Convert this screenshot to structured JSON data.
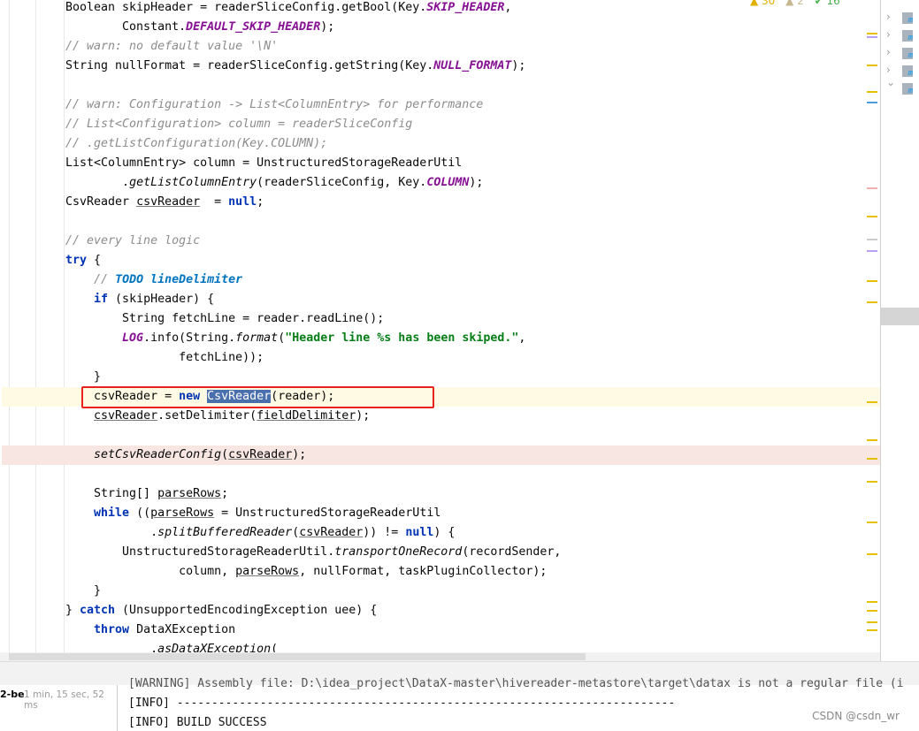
{
  "editor": {
    "lines": [
      [
        [
          "Boolean skipHeader = readerSliceConfig.getBool(Key.",
          ""
        ],
        [
          "SKIP_HEADER",
          "cn"
        ],
        [
          ",",
          ""
        ]
      ],
      [
        [
          "        Constant.",
          ""
        ],
        [
          "DEFAULT_SKIP_HEADER",
          "cn"
        ],
        [
          ");",
          ""
        ]
      ],
      [
        [
          "// warn: no default value '\\N'",
          "cm"
        ]
      ],
      [
        [
          "String nullFormat = readerSliceConfig.getString(Key.",
          ""
        ],
        [
          "NULL_FORMAT",
          "cn"
        ],
        [
          ");",
          ""
        ]
      ],
      [],
      [
        [
          "// warn: Configuration -> List<ColumnEntry> for performance",
          "cm"
        ]
      ],
      [
        [
          "// List<Configuration> column = readerSliceConfig",
          "cm"
        ]
      ],
      [
        [
          "// .getListConfiguration(Key.COLUMN);",
          "cm"
        ]
      ],
      [
        [
          "List<ColumnEntry> column = UnstructuredStorageReaderUtil",
          ""
        ]
      ],
      [
        [
          "        .",
          ""
        ],
        [
          "getListColumnEntry",
          "it"
        ],
        [
          "(readerSliceConfig, Key.",
          ""
        ],
        [
          "COLUMN",
          "cn"
        ],
        [
          ");",
          ""
        ]
      ],
      [
        [
          "CsvReader ",
          ""
        ],
        [
          "csvReader",
          "ul"
        ],
        [
          "  = ",
          ""
        ],
        [
          "null",
          "kw"
        ],
        [
          ";",
          ""
        ]
      ],
      [],
      [
        [
          "// every line logic",
          "cm"
        ]
      ],
      [
        [
          "try",
          "kw"
        ],
        [
          " {",
          ""
        ]
      ],
      [
        [
          "    ",
          ""
        ],
        [
          "// ",
          "cm"
        ],
        [
          "TODO lineDelimiter",
          "todo"
        ]
      ],
      [
        [
          "    ",
          ""
        ],
        [
          "if",
          "kw"
        ],
        [
          " (skipHeader) {",
          ""
        ]
      ],
      [
        [
          "        String fetchLine = reader.readLine();",
          ""
        ]
      ],
      [
        [
          "        ",
          ""
        ],
        [
          "LOG",
          "cn"
        ],
        [
          ".info(String.",
          ""
        ],
        [
          "format",
          "it"
        ],
        [
          "(",
          ""
        ],
        [
          "\"Header line %s has been skiped.\"",
          "st"
        ],
        [
          ",",
          ""
        ]
      ],
      [
        [
          "                fetchLine));",
          ""
        ]
      ],
      [
        [
          "    }",
          ""
        ]
      ],
      [
        [
          "    csvReader = ",
          ""
        ],
        [
          "new",
          "kw"
        ],
        [
          " ",
          ""
        ],
        [
          "CsvReader",
          "sel"
        ],
        [
          "(reader);",
          ""
        ]
      ],
      [
        [
          "    ",
          ""
        ],
        [
          "csvReader",
          "ul"
        ],
        [
          ".setDelimiter(",
          ""
        ],
        [
          "fieldDelimiter",
          "ul"
        ],
        [
          ");",
          ""
        ]
      ],
      [],
      [
        [
          "    ",
          ""
        ],
        [
          "setCsvReaderConfig",
          "it"
        ],
        [
          "(",
          ""
        ],
        [
          "csvReader",
          "ul"
        ],
        [
          ");",
          ""
        ]
      ],
      [],
      [
        [
          "    String[] ",
          ""
        ],
        [
          "parseRows",
          "ul"
        ],
        [
          ";",
          ""
        ]
      ],
      [
        [
          "    ",
          ""
        ],
        [
          "while",
          "kw"
        ],
        [
          " ((",
          ""
        ],
        [
          "parseRows",
          "ul"
        ],
        [
          " = UnstructuredStorageReaderUtil",
          ""
        ]
      ],
      [
        [
          "            .",
          ""
        ],
        [
          "splitBufferedReader",
          "it"
        ],
        [
          "(",
          ""
        ],
        [
          "csvReader",
          "ul"
        ],
        [
          ")) != ",
          ""
        ],
        [
          "null",
          "kw"
        ],
        [
          ") {",
          ""
        ]
      ],
      [
        [
          "        UnstructuredStorageReaderUtil.",
          ""
        ],
        [
          "transportOneRecord",
          "it"
        ],
        [
          "(recordSender,",
          ""
        ]
      ],
      [
        [
          "                column, ",
          ""
        ],
        [
          "parseRows",
          "ul"
        ],
        [
          ", nullFormat, taskPluginCollector);",
          ""
        ]
      ],
      [
        [
          "    }",
          ""
        ]
      ],
      [
        [
          "} ",
          ""
        ],
        [
          "catch",
          "kw"
        ],
        [
          " (UnsupportedEncodingException uee) {",
          ""
        ]
      ],
      [
        [
          "    ",
          ""
        ],
        [
          "throw",
          "kw"
        ],
        [
          " DataXException",
          ""
        ]
      ],
      [
        [
          "            .",
          ""
        ],
        [
          "asDataXException",
          "it"
        ],
        [
          "(",
          ""
        ]
      ]
    ],
    "current_line": 20,
    "error_line": 23
  },
  "inspections": {
    "warnings": "30",
    "weak_warnings": "2",
    "typos": "16"
  },
  "run_panel": {
    "task_label": "2-be",
    "duration": "1 min, 15 sec, 52 ms",
    "console": [
      "[WARNING] Assembly file: D:\\idea_project\\DataX-master\\hivereader-metastore\\target\\datax is not a regular file (i",
      "[INFO] ------------------------------------------------------------------------",
      "[INFO] BUILD SUCCESS"
    ]
  },
  "watermark": "CSDN @csdn_wr",
  "colors": {
    "highlight_box": "#e8221c",
    "selection": "#4a6fad",
    "keyword": "#0033b3"
  }
}
